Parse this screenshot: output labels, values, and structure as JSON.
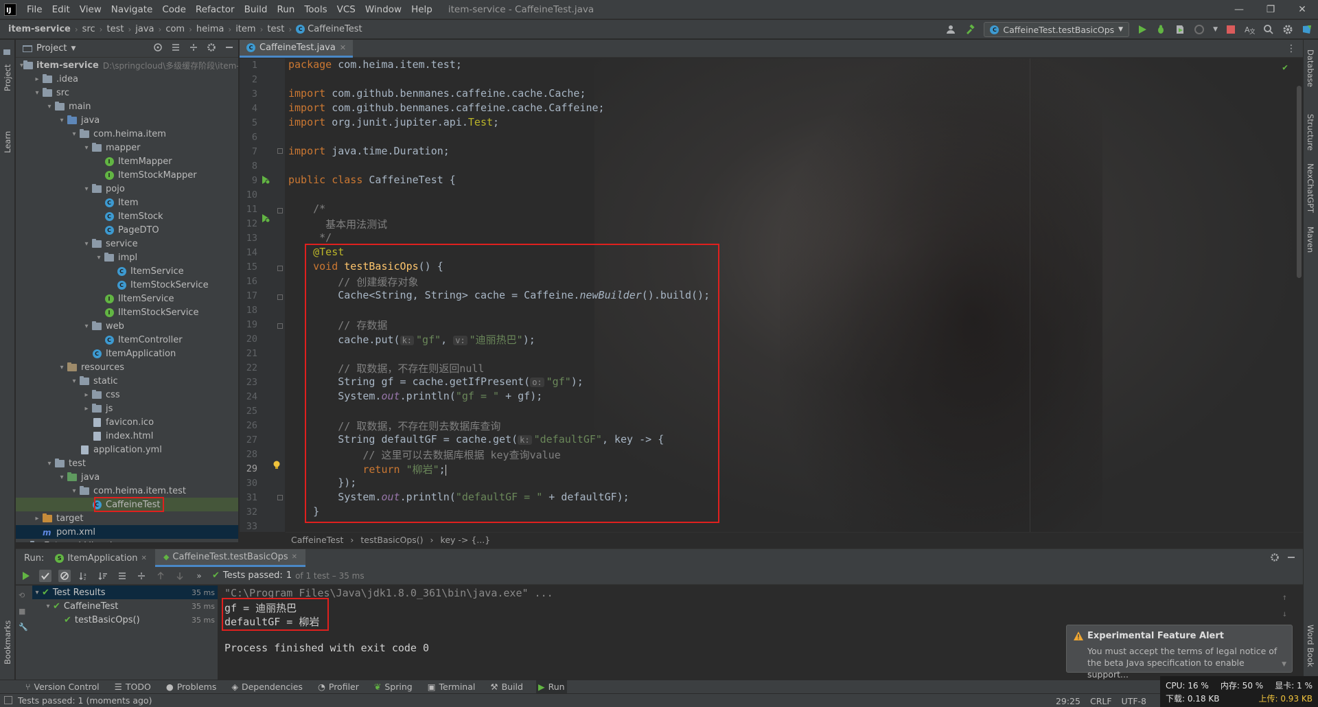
{
  "window": {
    "title": "item-service - CaffeineTest.java",
    "app_logo": "IJ",
    "menu": [
      "File",
      "Edit",
      "View",
      "Navigate",
      "Code",
      "Refactor",
      "Build",
      "Run",
      "Tools",
      "VCS",
      "Window",
      "Help"
    ]
  },
  "breadcrumbs": [
    "item-service",
    "src",
    "test",
    "java",
    "com",
    "heima",
    "item",
    "test",
    "CaffeineTest"
  ],
  "run_config": "CaffeineTest.testBasicOps",
  "left_stripe": [
    "Project",
    "Learn",
    "Bookmarks"
  ],
  "right_stripe": [
    "Database",
    "Structure",
    "NexChatGPT",
    "Maven",
    "Word Book"
  ],
  "project_panel": {
    "title": "Project",
    "tree": [
      {
        "label": "item-service",
        "hint": "D:\\springcloud\\多级缓存阶段\\item-s",
        "kind": "folder",
        "level": 0,
        "open": true
      },
      {
        "label": ".idea",
        "kind": "folder",
        "level": 1,
        "open": false
      },
      {
        "label": "src",
        "kind": "folder",
        "level": 1,
        "open": true
      },
      {
        "label": "main",
        "kind": "folder",
        "level": 2,
        "open": true
      },
      {
        "label": "java",
        "kind": "src",
        "level": 3,
        "open": true
      },
      {
        "label": "com.heima.item",
        "kind": "folder",
        "level": 4,
        "open": true
      },
      {
        "label": "mapper",
        "kind": "folder",
        "level": 5,
        "open": true
      },
      {
        "label": "ItemMapper",
        "kind": "interface",
        "level": 6
      },
      {
        "label": "ItemStockMapper",
        "kind": "interface",
        "level": 6
      },
      {
        "label": "pojo",
        "kind": "folder",
        "level": 5,
        "open": true
      },
      {
        "label": "Item",
        "kind": "class",
        "level": 6
      },
      {
        "label": "ItemStock",
        "kind": "class",
        "level": 6
      },
      {
        "label": "PageDTO",
        "kind": "class",
        "level": 6
      },
      {
        "label": "service",
        "kind": "folder",
        "level": 5,
        "open": true
      },
      {
        "label": "impl",
        "kind": "folder",
        "level": 6,
        "open": true
      },
      {
        "label": "ItemService",
        "kind": "class",
        "level": 7
      },
      {
        "label": "ItemStockService",
        "kind": "class",
        "level": 7
      },
      {
        "label": "IItemService",
        "kind": "interface",
        "level": 6
      },
      {
        "label": "IItemStockService",
        "kind": "interface",
        "level": 6
      },
      {
        "label": "web",
        "kind": "folder",
        "level": 5,
        "open": true
      },
      {
        "label": "ItemController",
        "kind": "class",
        "level": 6
      },
      {
        "label": "ItemApplication",
        "kind": "class",
        "level": 5
      },
      {
        "label": "resources",
        "kind": "res",
        "level": 3,
        "open": true
      },
      {
        "label": "static",
        "kind": "folder",
        "level": 4,
        "open": true
      },
      {
        "label": "css",
        "kind": "folder",
        "level": 5,
        "open": false
      },
      {
        "label": "js",
        "kind": "folder",
        "level": 5,
        "open": false
      },
      {
        "label": "favicon.ico",
        "kind": "file",
        "level": 5
      },
      {
        "label": "index.html",
        "kind": "file",
        "level": 5
      },
      {
        "label": "application.yml",
        "kind": "file",
        "level": 4
      },
      {
        "label": "test",
        "kind": "folder",
        "level": 2,
        "open": true
      },
      {
        "label": "java",
        "kind": "test",
        "level": 3,
        "open": true
      },
      {
        "label": "com.heima.item.test",
        "kind": "folder",
        "level": 4,
        "open": true
      },
      {
        "label": "CaffeineTest",
        "kind": "class",
        "level": 5,
        "selected": true
      },
      {
        "label": "target",
        "kind": "orange",
        "level": 1,
        "open": false
      },
      {
        "label": "pom.xml",
        "kind": "maven",
        "level": 1
      },
      {
        "label": "External Libraries",
        "kind": "folder",
        "level": 0,
        "open": false
      }
    ]
  },
  "editor": {
    "tab": "CaffeineTest.java",
    "line_numbers": [
      "1",
      "2",
      "3",
      "4",
      "5",
      "6",
      "7",
      "8",
      "9",
      "10",
      "11",
      "12",
      "13",
      "14",
      "15",
      "16",
      "17",
      "18",
      "19",
      "20",
      "21",
      "22",
      "23",
      "24",
      "25",
      "26",
      "27",
      "28",
      "29",
      "30",
      "31",
      "32",
      "33"
    ],
    "code": {
      "l1": [
        "package",
        " com.heima.item.test;"
      ],
      "l3": [
        "import",
        " com.github.benmanes.caffeine.cache.Cache;"
      ],
      "l4": [
        "import",
        " com.github.benmanes.caffeine.cache.Caffeine;"
      ],
      "l5": [
        "import",
        " org.junit.jupiter.api.",
        "Test",
        ";"
      ],
      "l7": [
        "import",
        " java.time.Duration;"
      ],
      "l9": [
        "public class",
        " CaffeineTest {"
      ],
      "l11": "    /*",
      "l12": "      基本用法测试",
      "l13": "     */",
      "l14": "    @Test",
      "l15": [
        "    void ",
        "testBasicOps",
        "() {"
      ],
      "l16": "        // 创建缓存对象",
      "l17": [
        "        Cache<String, String> cache = Caffeine.",
        "newBuilder",
        "().build();"
      ],
      "l19": "        // 存数据",
      "l20": [
        "        cache.put(",
        "k:",
        "\"gf\"",
        ", ",
        "v:",
        "\"迪丽热巴\"",
        ");"
      ],
      "l22": "        // 取数据，不存在则返回null",
      "l23": [
        "        String gf = cache.getIfPresent(",
        "o:",
        "\"gf\"",
        ");"
      ],
      "l24": [
        "        System.",
        "out",
        ".println(",
        "\"gf = \"",
        " + gf);"
      ],
      "l26": "        // 取数据，不存在则去数据库查询",
      "l27": [
        "        String defaultGF = cache.get(",
        "k:",
        "\"defaultGF\"",
        ", key -> {"
      ],
      "l28": "            // 这里可以去数据库根据 key查询value",
      "l29": [
        "            ",
        "return",
        " ",
        "\"柳岩\"",
        ";"
      ],
      "l30": "        });",
      "l31": [
        "        System.",
        "out",
        ".println(",
        "\"defaultGF = \"",
        " + defaultGF);"
      ],
      "l32": "    }"
    },
    "crumbs": [
      "CaffeineTest",
      "testBasicOps()",
      "key -> {...}"
    ]
  },
  "run_panel": {
    "label": "Run:",
    "tabs": [
      "ItemApplication",
      "CaffeineTest.testBasicOps"
    ],
    "status": "Tests passed:",
    "status_count": "1",
    "status_detail": "of 1 test – 35 ms",
    "tree": [
      {
        "label": "Test Results",
        "ms": "35 ms"
      },
      {
        "label": "CaffeineTest",
        "ms": "35 ms"
      },
      {
        "label": "testBasicOps()",
        "ms": "35 ms"
      }
    ],
    "console": {
      "cmd": "\"C:\\Program Files\\Java\\jdk1.8.0_361\\bin\\java.exe\" ...",
      "out1": "gf = 迪丽热巴",
      "out2": "defaultGF = 柳岩",
      "finish": "Process finished with exit code 0"
    }
  },
  "alert": {
    "title": "Experimental Feature Alert",
    "line1": "You must accept the terms of legal notice of",
    "line2": "the beta Java specification to enable support..."
  },
  "bottom_tabs": [
    "Version Control",
    "TODO",
    "Problems",
    "Dependencies",
    "Profiler",
    "Spring",
    "Terminal",
    "Build",
    "Run"
  ],
  "status_bar": {
    "message": "Tests passed: 1 (moments ago)",
    "position": "29:25",
    "line_sep": "CRLF",
    "encoding": "UTF-8"
  },
  "sys_monitor": {
    "cpu": "CPU: 16 %",
    "mem": "内存: 50 %",
    "gpu": "显卡: 1 %",
    "down": "下载: 0.18 KB",
    "up": "上传: 0.93 KB"
  },
  "colors": {
    "accent": "#4a88c7",
    "highlight": "#e0201e",
    "pass": "#62b543"
  }
}
